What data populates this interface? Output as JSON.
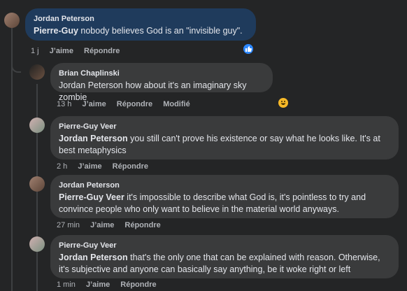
{
  "comments": [
    {
      "author": "Jordan Peterson",
      "mention": "Pierre-Guy",
      "text": " nobody believes God is an \"invisible guy\".",
      "time": "1 j",
      "like": "J’aime",
      "reply": "Répondre",
      "reaction": "like-reaction-icon"
    },
    {
      "author": "Brian Chaplinski",
      "mention": "",
      "text": "Jordan Peterson how about it's an imaginary sky zombie",
      "time": "13 h",
      "like": "J’aime",
      "reply": "Répondre",
      "edited": "Modifié",
      "reaction": "haha-reaction-icon"
    },
    {
      "author": "Pierre-Guy Veer",
      "mention": "Jordan Peterson",
      "text": " you still can't prove his existence or say what he looks like. It's at best metaphysics",
      "time": "2 h",
      "like": "J’aime",
      "reply": "Répondre"
    },
    {
      "author": "Jordan Peterson",
      "mention": "Pierre-Guy Veer",
      "text": " it's impossible to describe what God is, it's pointless to try and convince people who only want to believe in the material world anyways.",
      "time": "27 min",
      "like": "J’aime",
      "reply": "Répondre"
    },
    {
      "author": "Pierre-Guy Veer",
      "mention": "Jordan Peterson",
      "text": " that's the only one that can be explained with reason. Otherwise, it's subjective and anyone can basically say anything, be it woke right or left",
      "time": "1 min",
      "like": "J’aime",
      "reply": "Répondre"
    }
  ],
  "colors": {
    "background": "#242526",
    "bubble": "#3a3b3c",
    "highlight_bubble": "#1f3b5c",
    "like_blue": "#2d88ff",
    "haha_yellow": "#f7b928"
  }
}
